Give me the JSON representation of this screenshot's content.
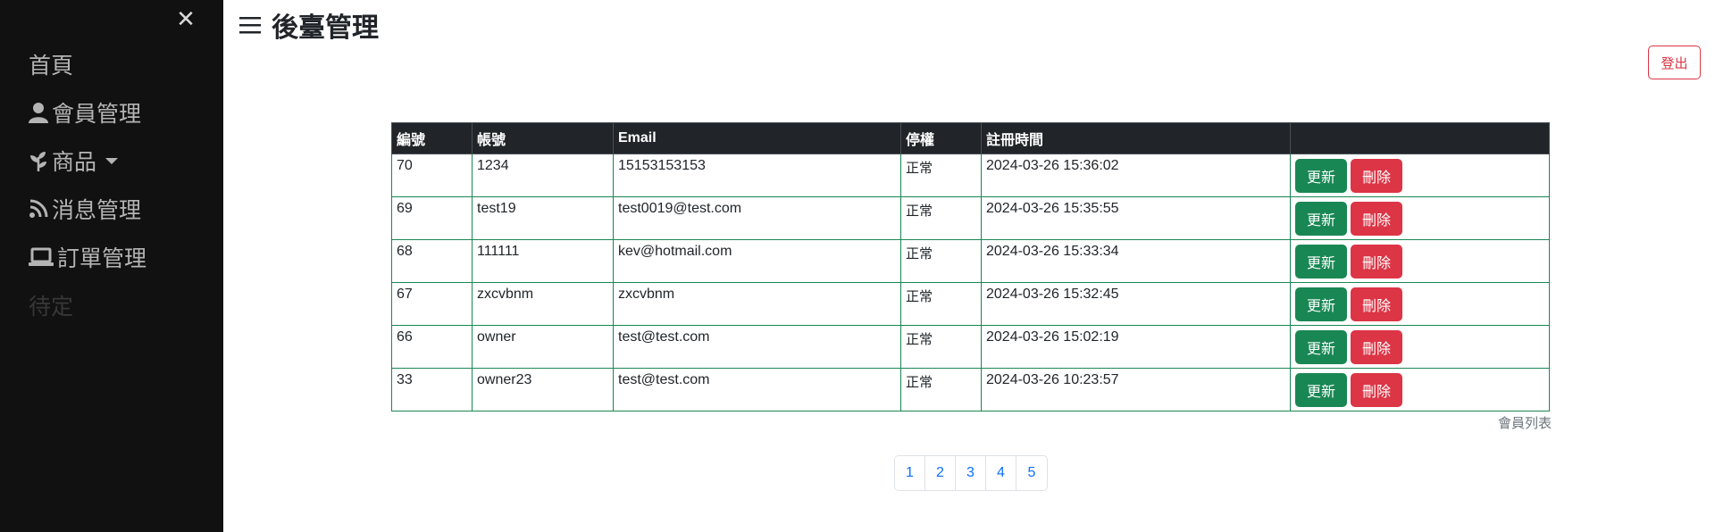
{
  "sidebar": {
    "close_symbol": "✕",
    "items": [
      {
        "label": "首頁",
        "icon": ""
      },
      {
        "label": "會員管理",
        "icon": "user-icon"
      },
      {
        "label": "商品",
        "icon": "plant-icon",
        "dropdown": true
      },
      {
        "label": "消息管理",
        "icon": "rss-icon"
      },
      {
        "label": "訂單管理",
        "icon": "laptop-icon"
      },
      {
        "label": "待定",
        "icon": ""
      }
    ]
  },
  "header": {
    "title": "後臺管理",
    "logout_label": "登出"
  },
  "table": {
    "columns": [
      "編號",
      "帳號",
      "Email",
      "停權",
      "註冊時間",
      ""
    ],
    "update_label": "更新",
    "delete_label": "刪除",
    "rows": [
      {
        "id": "70",
        "account": "1234",
        "email": "15153153153",
        "status": "正常",
        "registered": "2024-03-26 15:36:02"
      },
      {
        "id": "69",
        "account": "test19",
        "email": "test0019@test.com",
        "status": "正常",
        "registered": "2024-03-26 15:35:55"
      },
      {
        "id": "68",
        "account": "111111",
        "email": "kev@hotmail.com",
        "status": "正常",
        "registered": "2024-03-26 15:33:34"
      },
      {
        "id": "67",
        "account": "zxcvbnm",
        "email": "zxcvbnm",
        "status": "正常",
        "registered": "2024-03-26 15:32:45"
      },
      {
        "id": "66",
        "account": "owner",
        "email": "test@test.com",
        "status": "正常",
        "registered": "2024-03-26 15:02:19"
      },
      {
        "id": "33",
        "account": "owner23",
        "email": "test@test.com",
        "status": "正常",
        "registered": "2024-03-26 10:23:57"
      }
    ],
    "caption": "會員列表"
  },
  "pagination": {
    "pages": [
      "1",
      "2",
      "3",
      "4",
      "5"
    ]
  },
  "colors": {
    "sidebar_bg": "#111111",
    "update_button": "#198754",
    "delete_button": "#dc3545",
    "table_border": "#198754",
    "link": "#0d6efd"
  }
}
